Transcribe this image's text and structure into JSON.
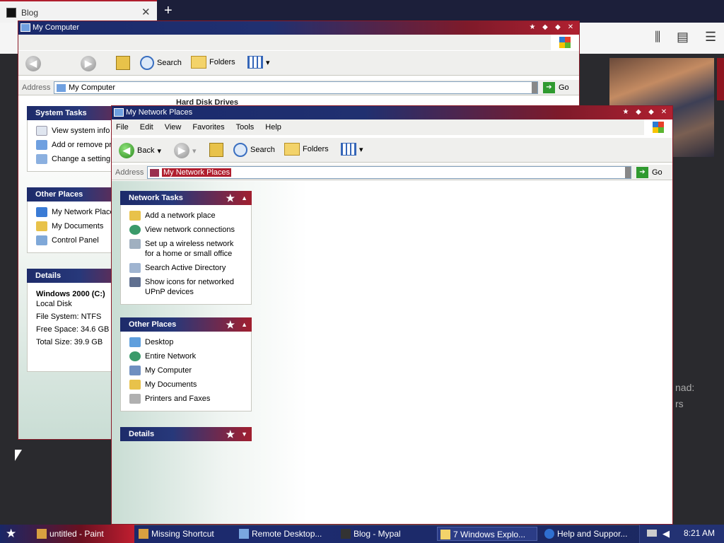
{
  "browser": {
    "tab_title": "Blog",
    "close": "✕",
    "new_tab": "+",
    "library_icon": "library-icon",
    "sidebar_icon": "sidebar-icon",
    "menu_icon": "hamburger-icon",
    "bg_text_1": "nad:",
    "bg_text_2": "rs"
  },
  "my_computer": {
    "title": "My Computer",
    "toolbar": {
      "search": "Search",
      "folders": "Folders"
    },
    "address_label": "Address",
    "address_value": "My Computer",
    "go": "Go",
    "section_heading": "Hard Disk Drives",
    "system_tasks": {
      "title": "System Tasks",
      "items": [
        "View system info",
        "Add or remove pr",
        "Change a setting"
      ]
    },
    "other_places": {
      "title": "Other Places",
      "items": [
        "My Network Place",
        "My Documents",
        "Control Panel"
      ]
    },
    "details": {
      "title": "Details",
      "name": "Windows 2000 (C:)",
      "type": "Local Disk",
      "fs": "File System: NTFS",
      "free": "Free Space: 34.6 GB",
      "total": "Total Size: 39.9 GB"
    }
  },
  "network_places": {
    "title": "My Network Places",
    "menu": [
      "File",
      "Edit",
      "View",
      "Favorites",
      "Tools",
      "Help"
    ],
    "toolbar": {
      "back": "Back",
      "search": "Search",
      "folders": "Folders"
    },
    "address_label": "Address",
    "address_value": "My Network Places",
    "go": "Go",
    "network_tasks": {
      "title": "Network Tasks",
      "items": [
        "Add a network place",
        "View network connections",
        "Set up a wireless network",
        "for a home or small office",
        "Search Active Directory",
        "Show icons for networked",
        "UPnP devices"
      ]
    },
    "other_places": {
      "title": "Other Places",
      "items": [
        "Desktop",
        "Entire Network",
        "My Computer",
        "My Documents",
        "Printers and Faxes"
      ]
    },
    "details": {
      "title": "Details"
    }
  },
  "taskbar": {
    "tasks": [
      "untitled - Paint",
      "Missing Shortcut",
      "Remote Desktop...",
      "Blog - Mypal",
      "7 Windows Explo...",
      "Help and Suppor..."
    ],
    "clock": "8:21 AM"
  },
  "colors": {
    "accent_blue": "#1d2b6a",
    "accent_red": "#a11f2f"
  }
}
